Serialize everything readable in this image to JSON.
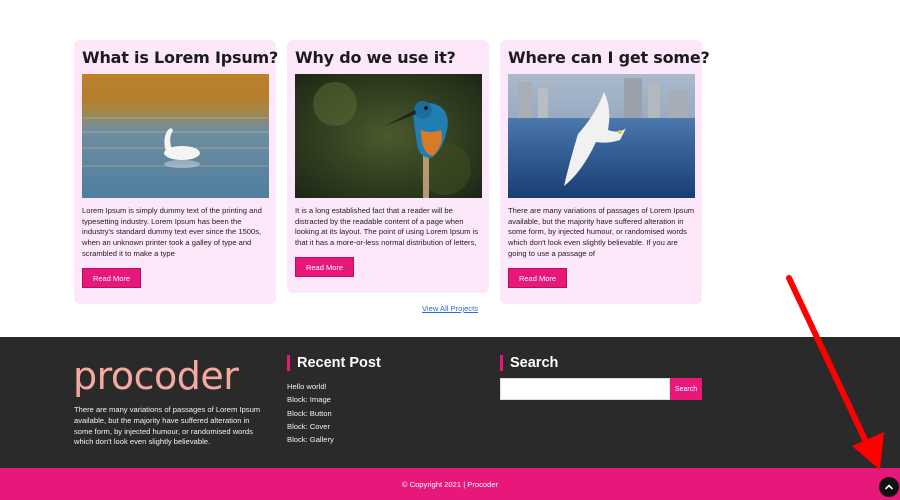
{
  "cards": [
    {
      "title": "What is Lorem Ipsum?",
      "text": "Lorem Ipsum is simply dummy text of the printing and typesetting industry. Lorem Ipsum has been the industry's standard dummy text ever since the 1500s, when an unknown printer took a galley of type and scrambled it to make a type",
      "button": "Read More",
      "image_icon": "swan-lake-photo"
    },
    {
      "title": "Why do we use it?",
      "text": "It is a long established fact that a reader will be distracted by the readable content of a page when looking at its layout. The point of using Lorem Ipsum is that it has a more-or-less normal distribution of letters,",
      "button": "Read More",
      "image_icon": "kingfisher-photo"
    },
    {
      "title": "Where can I get some?",
      "text": "There are many variations of passages of Lorem Ipsum available, but the majority have suffered alteration in some form, by injected humour, or randomised words which don't look even slightly believable. If you are going to use a passage of",
      "button": "Read More",
      "image_icon": "seagull-photo"
    }
  ],
  "view_all": "View All Projects",
  "footer": {
    "brand": "procoder",
    "about": "There are many variations of passages of Lorem Ipsum available, but the majority have suffered alteration in some form, by injected humour, or randomised words which don't look even slightly believable.",
    "recent_title": "Recent Post",
    "recent_posts": [
      "Hello world!",
      "Block: Image",
      "Block: Button",
      "Block: Cover",
      "Block: Gallery"
    ],
    "search_title": "Search",
    "search_value": "",
    "search_button": "Search",
    "copyright": "© Copyright 2021 | Procoder"
  },
  "colors": {
    "accent": "#e8187a",
    "card_bg": "#fde7fb",
    "footer_bg": "#2a2a2a",
    "brand": "#f5a9a0",
    "annotation": "#ff0000"
  },
  "icons": {
    "scroll_top": "chevron-up-icon",
    "annotation": "red-arrow-annotation"
  }
}
